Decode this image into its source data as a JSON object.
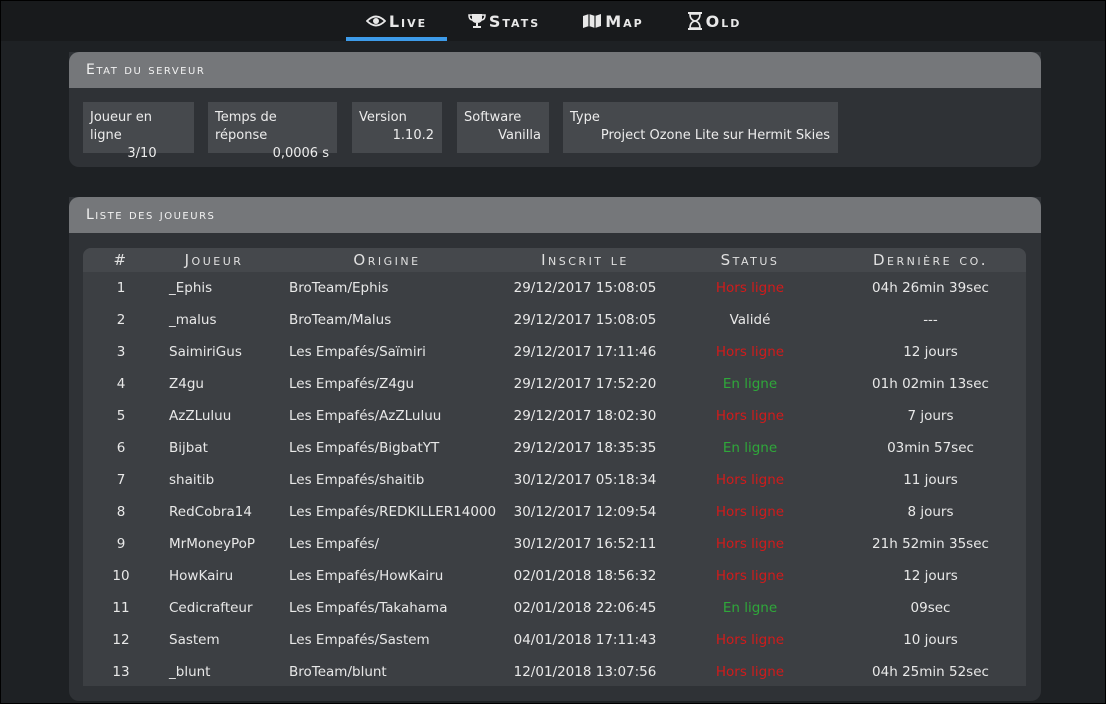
{
  "nav": {
    "tabs": [
      {
        "label": "Live",
        "icon": "eye-icon"
      },
      {
        "label": "Stats",
        "icon": "trophy-icon"
      },
      {
        "label": "Map",
        "icon": "map-icon"
      },
      {
        "label": "Old",
        "icon": "hourglass-icon"
      }
    ],
    "active_color": "#3d9be9"
  },
  "server": {
    "title": "Etat du serveur",
    "boxes": [
      {
        "label": "Joueur en ligne",
        "value": "3/10"
      },
      {
        "label": "Temps de réponse",
        "value": "0,0006 s"
      },
      {
        "label": "Version",
        "value": "1.10.2"
      },
      {
        "label": "Software",
        "value": "Vanilla"
      },
      {
        "label": "Type",
        "value": "Project Ozone Lite sur Hermit Skies"
      }
    ]
  },
  "players": {
    "title": "Liste des joueurs",
    "columns": [
      "#",
      "Joueur",
      "Origine",
      "Inscrit le",
      "Status",
      "Dernière co."
    ],
    "status_colors": {
      "offline": "#d11b1b",
      "online": "#2fa83a",
      "validated": "#e8e8e8"
    },
    "rows": [
      {
        "n": "1",
        "player": "_Ephis",
        "origin": "BroTeam/Ephis",
        "registered": "29/12/2017 15:08:05",
        "status": "Hors ligne",
        "state": "off",
        "last": "04h 26min 39sec"
      },
      {
        "n": "2",
        "player": "_malus",
        "origin": "BroTeam/Malus",
        "registered": "29/12/2017 15:08:05",
        "status": "Validé",
        "state": "ok",
        "last": "---"
      },
      {
        "n": "3",
        "player": "SaimiriGus",
        "origin": "Les Empafés/Saïmiri",
        "registered": "29/12/2017 17:11:46",
        "status": "Hors ligne",
        "state": "off",
        "last": "12 jours"
      },
      {
        "n": "4",
        "player": "Z4gu",
        "origin": "Les Empafés/Z4gu",
        "registered": "29/12/2017 17:52:20",
        "status": "En ligne",
        "state": "on",
        "last": "01h 02min 13sec"
      },
      {
        "n": "5",
        "player": "AzZLuluu",
        "origin": "Les Empafés/AzZLuluu",
        "registered": "29/12/2017 18:02:30",
        "status": "Hors ligne",
        "state": "off",
        "last": "7 jours"
      },
      {
        "n": "6",
        "player": "Bijbat",
        "origin": "Les Empafés/BigbatYT",
        "registered": "29/12/2017 18:35:35",
        "status": "En ligne",
        "state": "on",
        "last": "03min 57sec"
      },
      {
        "n": "7",
        "player": "shaitib",
        "origin": "Les Empafés/shaitib",
        "registered": "30/12/2017 05:18:34",
        "status": "Hors ligne",
        "state": "off",
        "last": "11 jours"
      },
      {
        "n": "8",
        "player": "RedCobra14",
        "origin": "Les Empafés/REDKILLER14000",
        "registered": "30/12/2017 12:09:54",
        "status": "Hors ligne",
        "state": "off",
        "last": "8 jours"
      },
      {
        "n": "9",
        "player": "MrMoneyPoP",
        "origin": "Les Empafés/",
        "registered": "30/12/2017 16:52:11",
        "status": "Hors ligne",
        "state": "off",
        "last": "21h 52min 35sec"
      },
      {
        "n": "10",
        "player": "HowKairu",
        "origin": "Les Empafés/HowKairu",
        "registered": "02/01/2018 18:56:32",
        "status": "Hors ligne",
        "state": "off",
        "last": "12 jours"
      },
      {
        "n": "11",
        "player": "Cedicrafteur",
        "origin": "Les Empafés/Takahama",
        "registered": "02/01/2018 22:06:45",
        "status": "En ligne",
        "state": "on",
        "last": "09sec"
      },
      {
        "n": "12",
        "player": "Sastem",
        "origin": "Les Empafés/Sastem",
        "registered": "04/01/2018 17:11:43",
        "status": "Hors ligne",
        "state": "off",
        "last": "10 jours"
      },
      {
        "n": "13",
        "player": "_blunt",
        "origin": "BroTeam/blunt",
        "registered": "12/01/2018 13:07:56",
        "status": "Hors ligne",
        "state": "off",
        "last": "04h 25min 52sec"
      }
    ]
  }
}
